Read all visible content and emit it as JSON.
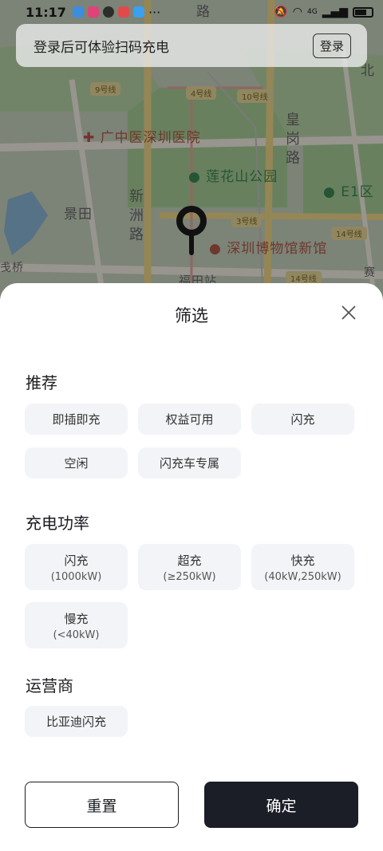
{
  "status_bar": {
    "time": "11:17",
    "more": "···",
    "network": "4G"
  },
  "login_banner": {
    "text": "登录后可体验扫码充电",
    "button": "登录"
  },
  "map": {
    "labels": {
      "hospital": "广中医深圳医院",
      "park": "莲花山公园",
      "museum": "深圳博物馆新馆",
      "jingtian": "景田",
      "xinzhou": "新洲路",
      "huanggang": "皇岗路",
      "e1": "E1区",
      "bei": "北",
      "futian_station": "福田站",
      "sai": "赛",
      "lu": "路",
      "qiao": "戋桥"
    },
    "road_tags": [
      "9号线",
      "4号线",
      "10号线",
      "3号线",
      "14号线",
      "14号线"
    ]
  },
  "filter_sheet": {
    "title": "筛选",
    "sections": {
      "recommend": {
        "title": "推荐",
        "options": [
          "即插即充",
          "权益可用",
          "闪充",
          "空闲",
          "闪充车专属"
        ]
      },
      "power": {
        "title": "充电功率",
        "options": [
          {
            "label": "闪充",
            "range": "(1000kW)"
          },
          {
            "label": "超充",
            "range": "(≥250kW)"
          },
          {
            "label": "快充",
            "range": "(40kW,250kW)"
          },
          {
            "label": "慢充",
            "range": "(<40kW)"
          }
        ]
      },
      "operator": {
        "title": "运营商",
        "options": [
          "比亚迪闪充"
        ]
      }
    },
    "buttons": {
      "reset": "重置",
      "confirm": "确定"
    }
  },
  "colors": {
    "chip_bg": "#f3f4f7",
    "confirm_bg": "#1b1e26",
    "text": "#1b1c20"
  }
}
